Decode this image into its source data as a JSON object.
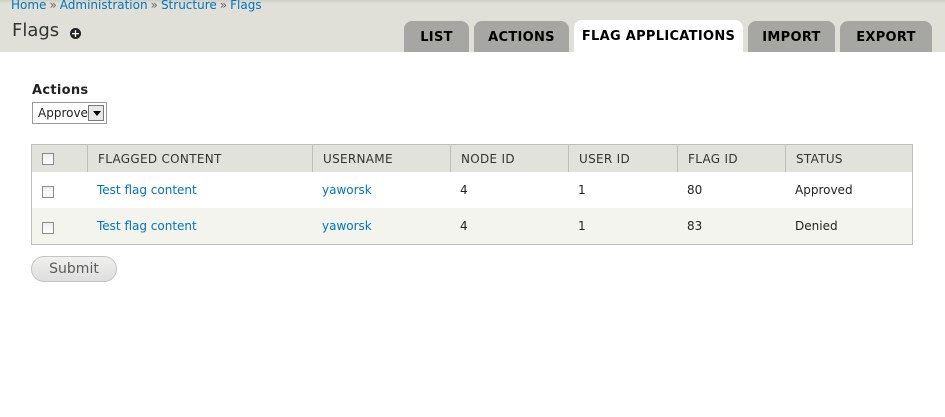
{
  "breadcrumb": {
    "items": [
      "Home",
      "Administration",
      "Structure",
      "Flags"
    ],
    "separator": "»"
  },
  "page": {
    "title": "Flags",
    "add_icon": "plus-circle-icon"
  },
  "tabs": [
    {
      "label": "List",
      "active": false
    },
    {
      "label": "Actions",
      "active": false
    },
    {
      "label": "Flag Applications",
      "active": true
    },
    {
      "label": "Import",
      "active": false
    },
    {
      "label": "Export",
      "active": false
    }
  ],
  "actions": {
    "label": "Actions",
    "selected": "Approve"
  },
  "table": {
    "columns": [
      "Flagged Content",
      "Username",
      "Node ID",
      "User ID",
      "Flag ID",
      "Status"
    ],
    "rows": [
      {
        "content": "Test flag content",
        "username": "yaworsk",
        "node_id": "4",
        "user_id": "1",
        "flag_id": "80",
        "status": "Approved"
      },
      {
        "content": "Test flag content",
        "username": "yaworsk",
        "node_id": "4",
        "user_id": "1",
        "flag_id": "83",
        "status": "Denied"
      }
    ]
  },
  "submit_label": "Submit",
  "colors": {
    "link": "#0074bd",
    "header_bg": "#e0e0d8",
    "tab_bg": "#a6a7a2",
    "table_header_bg": "#e1e2dc"
  }
}
